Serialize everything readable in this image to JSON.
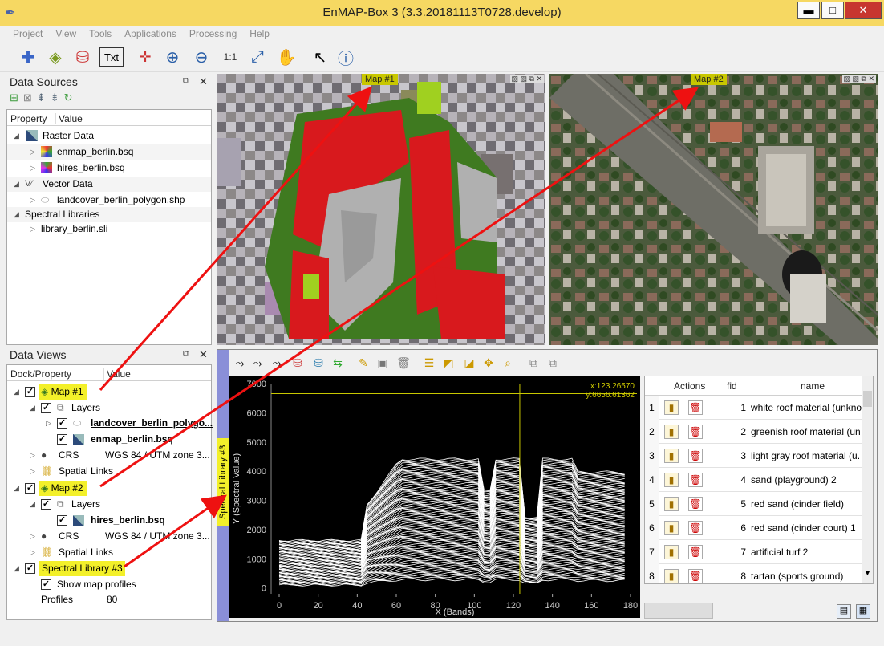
{
  "window": {
    "title": "EnMAP-Box 3 (3.3.20181113T0728.develop)",
    "min": "▬",
    "max": "□",
    "close": "✕"
  },
  "menu": [
    "Project",
    "View",
    "Tools",
    "Applications",
    "Processing",
    "Help"
  ],
  "toolbar": {
    "txt_label": "Txt"
  },
  "data_sources": {
    "title": "Data Sources",
    "col_property": "Property",
    "col_value": "Value",
    "raster_group": "Raster Data",
    "raster_items": [
      "enmap_berlin.bsq",
      "hires_berlin.bsq"
    ],
    "vector_group": "Vector Data",
    "vector_items": [
      "landcover_berlin_polygon.shp"
    ],
    "speclib_group": "Spectral Libraries",
    "speclib_items": [
      "library_berlin.sli"
    ]
  },
  "data_views": {
    "title": "Data Views",
    "col_property": "Dock/Property",
    "col_value": "Value",
    "map1": "Map #1",
    "layers": "Layers",
    "layer_a": "landcover_berlin_polygo...",
    "layer_b": "enmap_berlin.bsq",
    "crs": "CRS",
    "crs_value": "WGS 84 / UTM zone 3...",
    "spatial_links": "Spatial Links",
    "map2": "Map #2",
    "layer_c": "hires_berlin.bsq",
    "speclib": "Spectral Library #3",
    "show_profiles": "Show map profiles",
    "profiles": "Profiles",
    "profiles_value": "80"
  },
  "map1": {
    "tag": "Map #1"
  },
  "map2": {
    "tag": "Map #2"
  },
  "speclib_dock": {
    "tag": "Spectral Library #3"
  },
  "plot": {
    "xlabel": "X (Bands)",
    "ylabel": "Y (Spectral Value)",
    "x_ticks": [
      "0",
      "20",
      "40",
      "60",
      "80",
      "100",
      "120",
      "140",
      "160",
      "180"
    ],
    "y_ticks": [
      "0",
      "1000",
      "2000",
      "3000",
      "4000",
      "5000",
      "6000",
      "7000"
    ],
    "cursor_x": "x:123.26570",
    "cursor_y": "y:6656.61362"
  },
  "table": {
    "col_actions": "Actions",
    "col_fid": "fid",
    "col_name": "name",
    "rows": [
      {
        "n": "1",
        "fid": "1",
        "name": "white roof material (unkno"
      },
      {
        "n": "2",
        "fid": "2",
        "name": "greenish roof material (un"
      },
      {
        "n": "3",
        "fid": "3",
        "name": "light gray roof material (u."
      },
      {
        "n": "4",
        "fid": "4",
        "name": "sand (playground) 2"
      },
      {
        "n": "5",
        "fid": "5",
        "name": "red sand (cinder field)"
      },
      {
        "n": "6",
        "fid": "6",
        "name": "red sand (cinder court) 1"
      },
      {
        "n": "7",
        "fid": "7",
        "name": "artificial turf 2"
      },
      {
        "n": "8",
        "fid": "8",
        "name": "tartan (sports ground)"
      }
    ]
  },
  "colors": {
    "highlight": "#f3f02a",
    "maptag": "#c8c700",
    "arrow": "#ee1111",
    "titlebar": "#f6d862"
  }
}
